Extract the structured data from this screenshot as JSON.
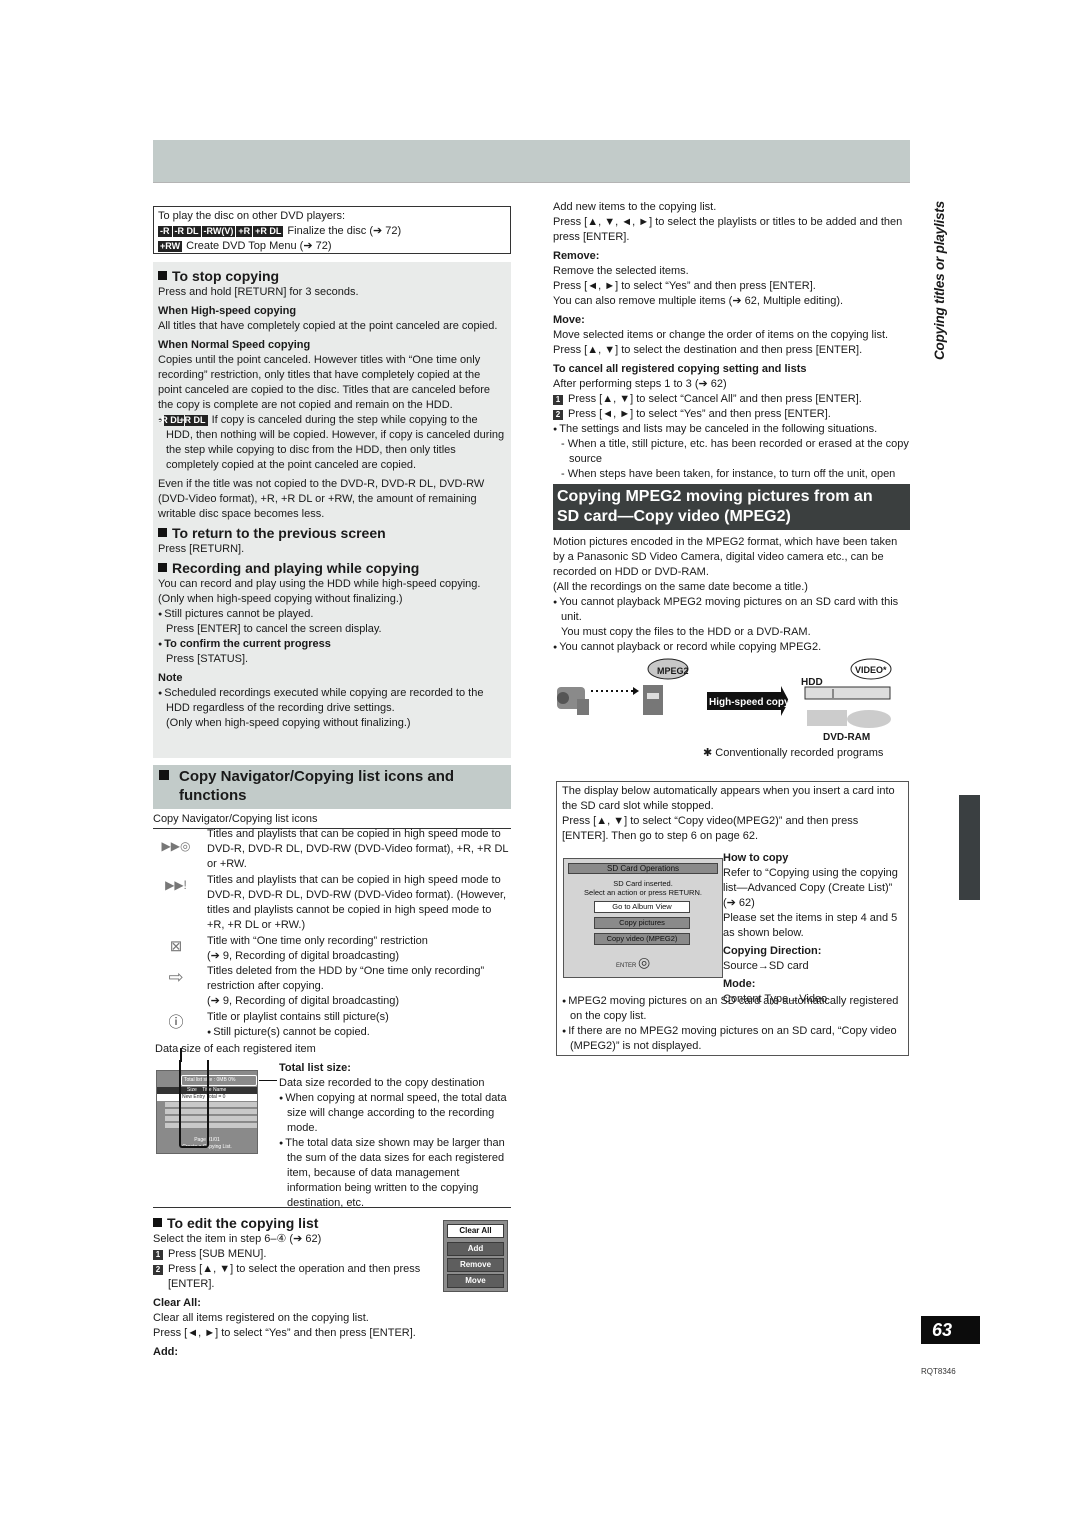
{
  "page": {
    "number": "63",
    "code": "RQT8346",
    "side_tab": "Copying titles or playlists",
    "colors": {
      "band": "#c2cbc9",
      "panel": "#e9ebea",
      "dark_heading": "#3b3f3f",
      "tab": "#3a3f41",
      "page_box": "#0c0c0c"
    }
  },
  "disc_box": {
    "intro": "To play the disc on other DVD players:",
    "line1_tags": [
      "-R",
      "-R DL",
      "-RW(V)",
      "+R",
      "+R DL"
    ],
    "line1_text": "Finalize the disc (➔ 72)",
    "line2_tag": "+RW",
    "line2_text": "Create DVD Top Menu (➔ 72)"
  },
  "stop_copying": {
    "title": "To stop copying",
    "body": "Press and hold [RETURN] for 3 seconds.",
    "high_speed_title": "When High-speed copying",
    "high_speed_body": "All titles that have completely copied at the point canceled are copied.",
    "normal_title": "When Normal Speed copying",
    "normal_body": "Copies until the point canceled. However titles with “One time only recording” restriction, only titles that have completely copied at the point canceled are copied to the disc. Titles that are canceled before the copy is complete are not copied and remain on the HDD.",
    "bullet_tags": [
      "-R DL",
      "+R DL"
    ],
    "bullet_text": "If copy is canceled during the step while copying to the HDD, then nothing will be copied. However, if copy is canceled during the step while copying to disc from the HDD, then only titles completely copied at the point canceled are copied.",
    "remaining": "Even if the title was not copied to the DVD-R, DVD-R DL, DVD-RW (DVD-Video format), +R, +R DL or +RW, the amount of remaining writable disc space becomes less."
  },
  "return_prev": {
    "title": "To return to the previous screen",
    "body": "Press [RETURN]."
  },
  "rec_play": {
    "title": "Recording and playing while copying",
    "body": "You can record and play using the HDD while high-speed copying. (Only when high-speed copying without finalizing.)",
    "bullet1": "Still pictures cannot be played.",
    "bullet1_sub": "Press [ENTER] to cancel the screen display.",
    "bullet2": "To confirm the current progress",
    "bullet2_sub": "Press [STATUS].",
    "note_title": "Note",
    "note_bullet": "Scheduled recordings executed while copying are recorded to the HDD regardless of the recording drive settings.",
    "note_sub": "(Only when high-speed copying without finalizing.)"
  },
  "nav_icons": {
    "title_line1": "Copy Navigator/Copying list icons and",
    "title_line2": "functions",
    "caption": "Copy Navigator/Copying list icons",
    "items": [
      {
        "icon": "high-speed-disc-icon",
        "glyph": "▶▶◎",
        "text": "Titles and playlists that can be copied in high speed mode to DVD-R, DVD-R DL, DVD-RW (DVD-Video format), +R, +R DL or +RW."
      },
      {
        "icon": "high-speed-limited-icon",
        "glyph": "▶▶!",
        "text": "Titles and playlists that can be copied in high speed mode to DVD-R, DVD-R DL, DVD-RW (DVD-Video format). (However, titles and playlists cannot be copied in high speed mode to +R, +R DL or +RW.)"
      },
      {
        "icon": "one-time-recording-icon",
        "glyph": "⊠",
        "text": "Title with “One time only recording” restriction",
        "sub": "(➔ 9, Recording of digital broadcasting)"
      },
      {
        "icon": "deleted-move-icon",
        "glyph": "⇨",
        "text": "Titles deleted from the HDD by “One time only recording” restriction after copying.",
        "sub": "(➔ 9, Recording of digital broadcasting)"
      },
      {
        "icon": "still-picture-warning-icon",
        "glyph": "ⓘ",
        "text": "Title or playlist contains still picture(s)",
        "sub": "Still picture(s) cannot be copied."
      }
    ],
    "data_size_caption": "Data size of each registered item"
  },
  "list_screen": {
    "total_label": "Total list size :",
    "total_value": "0MB",
    "total_pct": "0%",
    "col_size": "Size",
    "col_title": "Title Name",
    "new_entry": "New Entry",
    "total_count": "Total = 0",
    "page": "Page 01/01",
    "footer": "Create a Copying List."
  },
  "total_list": {
    "title": "Total list size:",
    "body": "Data size recorded to the copy destination",
    "bullet1": "When copying at normal speed, the total data size will change according to the recording mode.",
    "bullet2": "The total data size shown may be larger than the sum of the data sizes for each registered item, because of data management information being written to the copying destination, etc."
  },
  "edit_list": {
    "title": "To edit the copying list",
    "intro": "Select the item in step 6–④ (➔ 62)",
    "step1": "Press [SUB MENU].",
    "step2": "Press [▲, ▼] to select the operation and then press [ENTER].",
    "clear_title": "Clear All:",
    "clear_body1": "Clear all items registered on the copying list.",
    "clear_body2": "Press [◄, ►] to select “Yes” and then press [ENTER].",
    "add_title": "Add:",
    "menu": [
      "Clear All",
      "Add",
      "Remove",
      "Move"
    ]
  },
  "right_top": {
    "add_body1": "Add new items to the copying list.",
    "add_body2": "Press [▲, ▼, ◄, ►] to select the playlists or titles to be added and then press [ENTER].",
    "remove_title": "Remove:",
    "remove_body1": "Remove the selected items.",
    "remove_body2": "Press [◄, ►] to select “Yes” and then press [ENTER].",
    "remove_body3": "You can also remove multiple items (➔ 62, Multiple editing).",
    "move_title": "Move:",
    "move_body1": "Move selected items or change the order of items on the copying list.",
    "move_body2": "Press [▲, ▼] to select the destination and then press [ENTER].",
    "cancel_title": "To cancel all registered copying setting and lists",
    "cancel_intro": "After performing steps 1 to 3 (➔ 62)",
    "cancel_step1": "Press [▲, ▼] to select “Cancel All” and then press [ENTER].",
    "cancel_step2": "Press [◄, ►] to select “Yes” and then press [ENTER].",
    "cancel_bullet": "The settings and lists may be canceled in the following situations.",
    "cancel_dash1": "When a title, still picture, etc. has been recorded or erased at the copy source",
    "cancel_dash2": "When steps have been taken, for instance, to turn off the unit, open the tray, change the copy direction, etc."
  },
  "mpeg2": {
    "heading_line1": "Copying MPEG2 moving pictures from an",
    "heading_line2": "SD card—Copy video (MPEG2)",
    "body1": "Motion pictures encoded in the MPEG2 format, which have been taken by a Panasonic SD Video Camera, digital video camera etc., can be recorded on HDD or DVD-RAM.",
    "body2": "(All the recordings on the same date become a title.)",
    "bullet1": "You cannot playback MPEG2 moving pictures on an SD card with this unit.",
    "bullet1_sub": "You must copy the files to the HDD or a DVD-RAM.",
    "bullet2": "You cannot playback or record while copying MPEG2.",
    "diagram": {
      "bubble_mpeg2": "MPEG2",
      "arrow_label": "High-speed copy",
      "hdd": "HDD",
      "bubble_video": "VIDEO*",
      "dvdram": "DVD-RAM",
      "footnote": "✱ Conventionally recorded programs"
    }
  },
  "sd_box": {
    "intro1": "The display below automatically appears when you insert a card into the SD card slot while stopped.",
    "intro2": "Press [▲, ▼] to select “Copy video(MPEG2)” and then press [ENTER]. Then go to step 6 on page 62.",
    "screen": {
      "title": "SD Card Operations",
      "msg1": "SD Card inserted.",
      "msg2": "Select an action or press RETURN.",
      "buttons": [
        "Go to Album View",
        "Copy pictures",
        "Copy video (MPEG2)"
      ],
      "enter": "ENTER"
    },
    "howto_title": "How to copy",
    "howto_body1": "Refer to “Copying using the copying list—Advanced Copy (Create List)” (➔ 62)",
    "howto_body2": "Please set the items in step 4 and 5 as shown below.",
    "direction_title": "Copying Direction:",
    "direction_value": "Source→SD card",
    "mode_title": "Mode:",
    "mode_value": "Content Type→Video",
    "bullet1": "MPEG2 moving pictures on an SD card are automatically registered on the copy list.",
    "bullet2": "If there are no MPEG2 moving pictures on an SD card, “Copy video (MPEG2)” is not displayed."
  }
}
